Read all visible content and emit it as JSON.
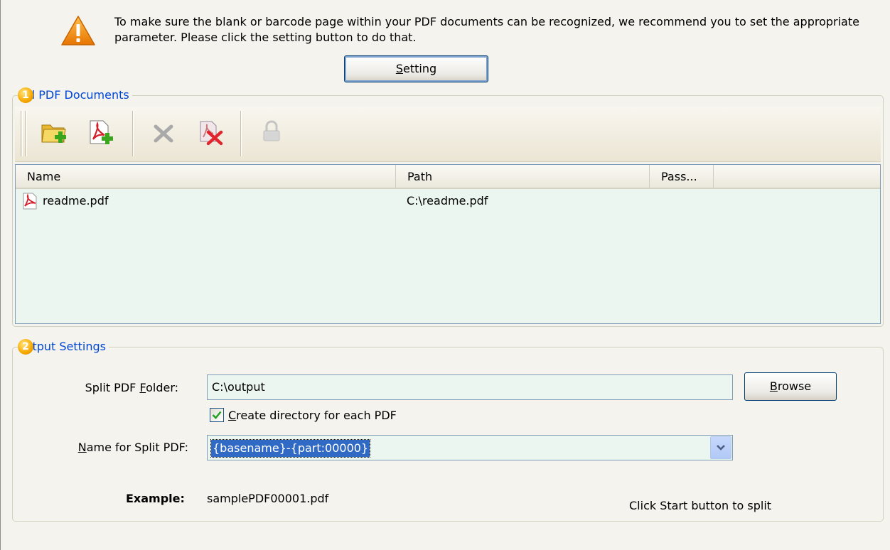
{
  "notice": {
    "text": "To make sure the blank or barcode page within your PDF documents can be recognized, we recommend you to set the appropriate parameter. Please click the setting button to do that.",
    "icon": "warning-icon",
    "setting_button": {
      "pre": "",
      "accel": "S",
      "post": "etting"
    }
  },
  "add_documents": {
    "badge": "1",
    "legend": "d PDF Documents",
    "toolbar": [
      {
        "name": "add-folder-button",
        "icon": "folder-add-icon"
      },
      {
        "name": "add-pdf-button",
        "icon": "pdf-add-icon"
      },
      {
        "name": "remove-button",
        "icon": "remove-x-icon"
      },
      {
        "name": "remove-all-button",
        "icon": "remove-all-icon"
      },
      {
        "name": "unlock-button",
        "icon": "lock-icon"
      }
    ],
    "columns": [
      "Name",
      "Path",
      "Pass..."
    ],
    "rows": [
      {
        "name": "readme.pdf",
        "path": "C:\\readme.pdf",
        "password": ""
      }
    ]
  },
  "output": {
    "badge": "2",
    "legend": "itput Settings",
    "folder_label": {
      "pre": "Split PDF ",
      "accel": "F",
      "post": "older:"
    },
    "folder_value": "C:\\output",
    "browse": {
      "pre": "",
      "accel": "B",
      "post": "rowse"
    },
    "create_dir": {
      "checked": true,
      "pre": "",
      "accel": "C",
      "post": "reate directory for each PDF"
    },
    "name_label": {
      "pre": "",
      "accel": "N",
      "post": "ame for Split PDF:"
    },
    "name_value": "{basename}-{part:00000}",
    "example_label": "Example:",
    "example_value": "samplePDF00001.pdf",
    "hint": "Click Start button to split"
  },
  "colors": {
    "accent": "#0046d5",
    "list_bg": "#ebf6f1",
    "selection": "#316ac5"
  }
}
